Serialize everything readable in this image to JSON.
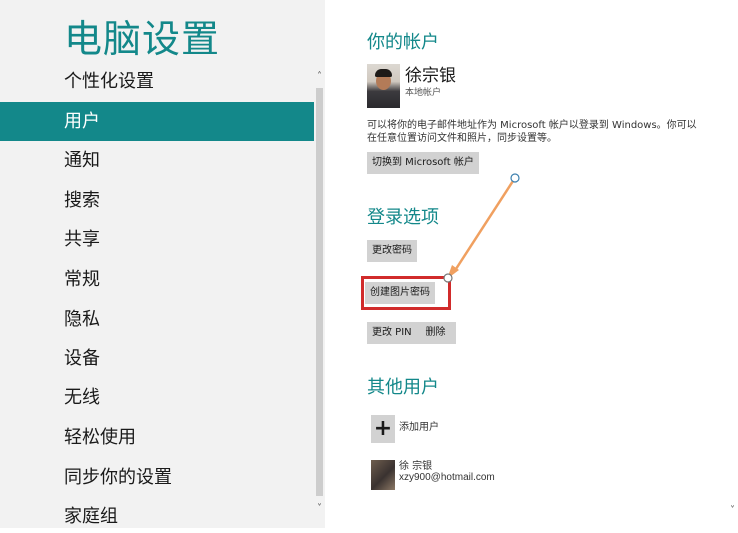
{
  "left_pane": {
    "title": "电脑设置",
    "items": [
      {
        "label": "个性化设置",
        "selected": false
      },
      {
        "label": "用户",
        "selected": true
      },
      {
        "label": "通知",
        "selected": false
      },
      {
        "label": "搜索",
        "selected": false
      },
      {
        "label": "共享",
        "selected": false
      },
      {
        "label": "常规",
        "selected": false
      },
      {
        "label": "隐私",
        "selected": false
      },
      {
        "label": "设备",
        "selected": false
      },
      {
        "label": "无线",
        "selected": false
      },
      {
        "label": "轻松使用",
        "selected": false
      },
      {
        "label": "同步你的设置",
        "selected": false
      },
      {
        "label": "家庭组",
        "selected": false
      }
    ],
    "scroll_up_glyph": "˄",
    "scroll_down_glyph": "˅"
  },
  "account": {
    "title": "你的帐户",
    "name": "徐宗银",
    "type": "本地帐户",
    "description": "可以将你的电子邮件地址作为 Microsoft 帐户以登录到 Windows。你可以在任意位置访问文件和照片，同步设置等。",
    "switch_button": "切换到 Microsoft 帐户"
  },
  "signin": {
    "title": "登录选项",
    "change_password_button": "更改密码",
    "picture_password_button": "创建图片密码",
    "change_pin_button": "更改 PIN",
    "delete_button": "删除"
  },
  "other_users": {
    "title": "其他用户",
    "add_icon_glyph": "+",
    "add_user_label": "添加用户",
    "users": [
      {
        "name": "徐 宗银",
        "email": "xzy900@hotmail.com"
      }
    ]
  },
  "colors": {
    "accent": "#13888a",
    "highlight_box": "#d12b2b",
    "annotation_arrow": "#f0a060"
  }
}
